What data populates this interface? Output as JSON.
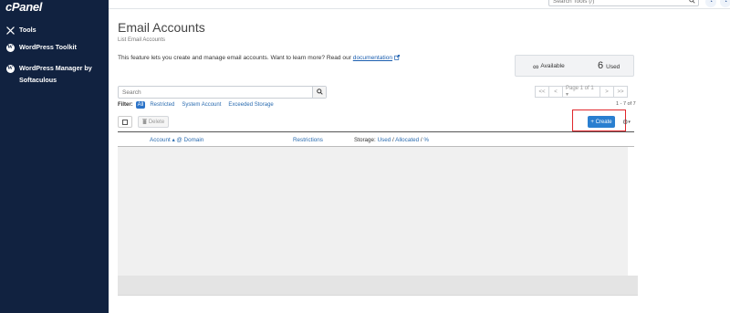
{
  "brand": {
    "logo_text": "cPanel"
  },
  "sidebar": {
    "items": [
      {
        "label": "Tools",
        "icon": "tools-icon"
      },
      {
        "label": "WordPress Toolkit",
        "icon": "wordpress-icon"
      },
      {
        "label": "WordPress Manager by Softaculous",
        "icon": "wordpress-icon"
      }
    ]
  },
  "topbar": {
    "search_placeholder": "Search Tools (/)"
  },
  "page": {
    "title": "Email Accounts",
    "breadcrumb": "List Email Accounts",
    "intro_text": "This feature lets you create and manage email accounts. Want to learn more? Read our ",
    "intro_link": "documentation"
  },
  "stats": {
    "available_label": "Available",
    "available_symbol": "∞",
    "used_count": "6",
    "used_label": "Used"
  },
  "search": {
    "placeholder": "Search"
  },
  "pagination": {
    "first": "<<",
    "prev": "<",
    "page_label": "Page 1 of 1 ▾",
    "next": ">",
    "last": ">>",
    "count_text": "1 - 7 of 7"
  },
  "filter": {
    "label": "Filter:",
    "options": [
      "All",
      "Restricted",
      "System Account",
      "Exceeded Storage"
    ],
    "active": "All"
  },
  "toolbar": {
    "delete_label": "Delete",
    "create_label": "+ Create"
  },
  "table": {
    "columns": {
      "account": "Account ▴ @ Domain",
      "restrictions": "Restrictions",
      "storage_prefix": "Storage: ",
      "storage_used": "Used",
      "storage_sep1": " / ",
      "storage_allocated": "Allocated",
      "storage_sep2": " / ",
      "storage_percent": "%"
    }
  },
  "colors": {
    "sidebar_bg": "#112240",
    "primary_button": "#2a7fd0",
    "highlight_border": "#e0262b",
    "link": "#2b6cb0"
  }
}
